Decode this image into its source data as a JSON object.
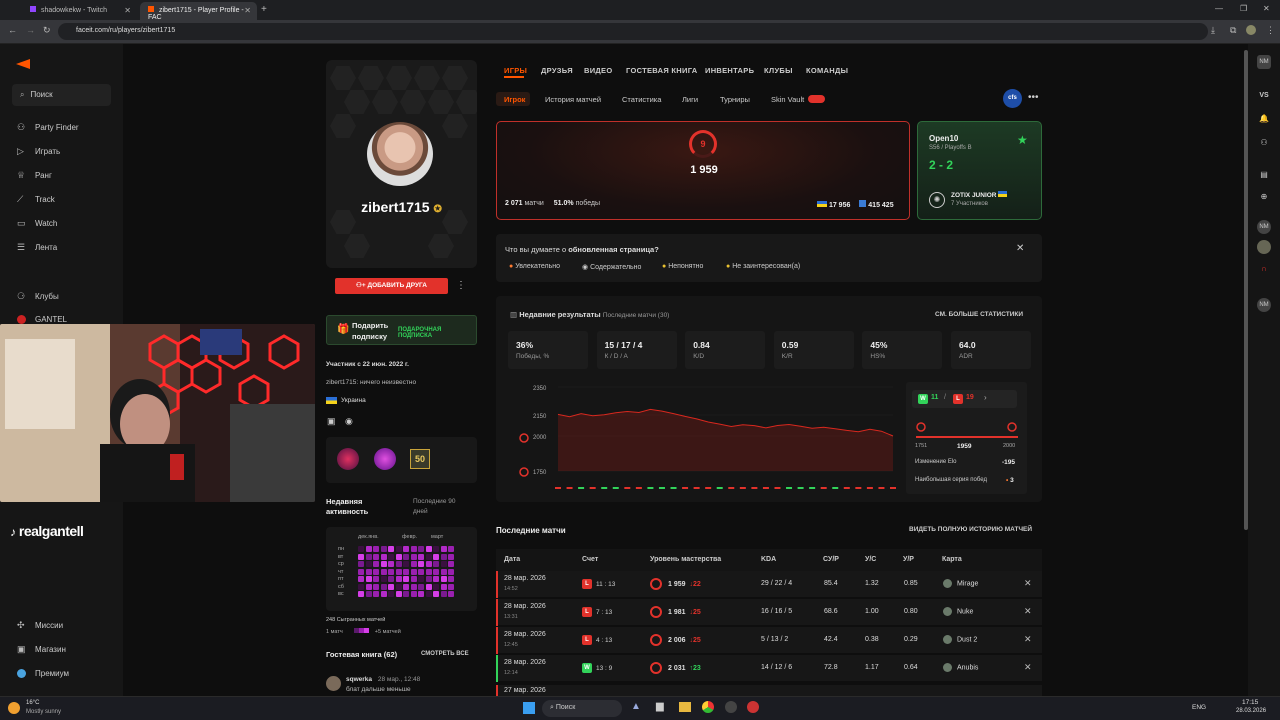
{
  "browser": {
    "tabs": [
      {
        "label": "shadowkekw - Twitch",
        "active": false
      },
      {
        "label": "zibert1715 - Player Profile - FAC",
        "active": true
      }
    ],
    "url": "faceit.com/ru/players/zibert1715"
  },
  "sidebar": {
    "search_label": "Поиск",
    "items": [
      "Party Finder",
      "Играть",
      "Ранг",
      "Track",
      "Watch",
      "Лента"
    ],
    "clubs_label": "Клубы",
    "club_name": "GANTEL",
    "bottom_items": [
      "Миссии",
      "Магазин",
      "Премиум"
    ]
  },
  "overlay": {
    "streamer": "realgantell"
  },
  "profile": {
    "nickname": "zibert1715",
    "add_friend": "ДОБАВИТЬ ДРУГА",
    "gift_line1": "Подарить",
    "gift_line2": "подписку",
    "gift_badge": "ПОДАРОЧНАЯ ПОДПИСКА",
    "member_since": "Участник с 22 июн. 2022 г.",
    "bio": "zibert1715: ничего неизвестно",
    "country": "Украина",
    "badge_50": "50",
    "activity_title_1": "Недавняя",
    "activity_title_2": "активность",
    "activity_range_1": "Последние 90",
    "activity_range_2": "дней",
    "months": [
      "дек.янв.",
      "февр.",
      "март"
    ],
    "days": [
      "пн",
      "вт",
      "ср",
      "чт",
      "пт",
      "сб",
      "вс"
    ],
    "matches_played": "248 Сыгранных матчей",
    "legend_min": "1 матч",
    "legend_max": "+5 матчей",
    "guestbook_title": "Гостевая книга (62)",
    "guestbook_all": "СМОТРЕТЬ ВСЕ",
    "guest_name": "sqwerka",
    "guest_date": "28 мар., 12:48",
    "guest_text": "блат дальше меньше"
  },
  "topnav": [
    "ИГРЫ",
    "ДРУЗЬЯ",
    "ВИДЕО",
    "ГОСТЕВАЯ КНИГА",
    "ИНВЕНТАРЬ",
    "КЛУБЫ",
    "КОМАНДЫ"
  ],
  "subnav": [
    "Игрок",
    "История матчей",
    "Статистика",
    "Лиги",
    "Турниры",
    "Skin Vault"
  ],
  "rank": {
    "level": "9",
    "elo": "1 959",
    "matches": "2 071",
    "matches_label": "матчи",
    "winrate": "51.0%",
    "winrate_label": "победы",
    "country_rank": "17 956",
    "global_rank": "415 425"
  },
  "tournament": {
    "name": "Open10",
    "stage": "S56 / Playoffs B",
    "score": "2 - 2",
    "team": "ZOTIX JUNIOR",
    "members": "7 Участников"
  },
  "feedback": {
    "question_a": "Что вы думаете о ",
    "question_b": "обновленная страница?",
    "options": [
      "Увлекательно",
      "Содержательно",
      "Непонятно",
      "Не заинтересован(а)"
    ]
  },
  "recent": {
    "title": "Недавние результаты",
    "subtitle": "Последние матчи (30)",
    "more": "СМ. БОЛЬШЕ СТАТИСТИКИ",
    "stats": [
      {
        "value": "36%",
        "label": "Победы, %"
      },
      {
        "value": "15 / 17 / 4",
        "label": "К / D / A"
      },
      {
        "value": "0.84",
        "label": "K/D"
      },
      {
        "value": "0.59",
        "label": "K/R"
      },
      {
        "value": "45%",
        "label": "HS%"
      },
      {
        "value": "64.0",
        "label": "ADR"
      }
    ],
    "wins": "11",
    "losses": "19",
    "elo_min": "1751",
    "elo_cur": "1959",
    "elo_max": "2000",
    "elo_change_label": "Изменение Elo",
    "elo_change": "-195",
    "streak_label": "Наибольшая серия побед",
    "streak": "3"
  },
  "chart_data": {
    "type": "line",
    "yticks": [
      "2350",
      "2150",
      "2000",
      "1750"
    ],
    "ylim": [
      1750,
      2350
    ],
    "values": [
      2154,
      2138,
      2160,
      2145,
      2152,
      2166,
      2175,
      2168,
      2190,
      2178,
      2160,
      2140,
      2122,
      2100,
      2085,
      2068,
      2080,
      2074,
      2058,
      2075,
      2082,
      2070,
      2055,
      2063,
      2052,
      2040,
      2030,
      2048,
      2034,
      2000
    ],
    "results": [
      "L",
      "L",
      "W",
      "L",
      "W",
      "W",
      "L",
      "L",
      "W",
      "W",
      "W",
      "L",
      "L",
      "L",
      "W",
      "L",
      "L",
      "L",
      "L",
      "L",
      "W",
      "W",
      "W",
      "L",
      "W",
      "L",
      "L",
      "L",
      "L",
      "L"
    ]
  },
  "matches": {
    "title": "Последние матчи",
    "full_history": "ВИДЕТЬ ПОЛНУЮ ИСТОРИЮ МАТЧЕЙ",
    "headers": [
      "Дата",
      "Счет",
      "Уровень мастерства",
      "KDA",
      "СУ/Р",
      "У/С",
      "У/Р",
      "Карта"
    ],
    "rows": [
      {
        "date": "28 мар. 2026",
        "time": "14:52",
        "result": "L",
        "score": "11 : 13",
        "elo": "1 959",
        "delta": "22",
        "kda": "29 / 22 / 4",
        "adr": "85.4",
        "kd": "1.32",
        "kr": "0.85",
        "map": "Mirage"
      },
      {
        "date": "28 мар. 2026",
        "time": "13:31",
        "result": "L",
        "score": "7 : 13",
        "elo": "1 981",
        "delta": "25",
        "kda": "16 / 16 / 5",
        "adr": "68.6",
        "kd": "1.00",
        "kr": "0.80",
        "map": "Nuke"
      },
      {
        "date": "28 мар. 2026",
        "time": "12:45",
        "result": "L",
        "score": "4 : 13",
        "elo": "2 006",
        "delta": "25",
        "kda": "5 / 13 / 2",
        "adr": "42.4",
        "kd": "0.38",
        "kr": "0.29",
        "map": "Dust 2"
      },
      {
        "date": "28 мар. 2026",
        "time": "12:14",
        "result": "W",
        "score": "13 : 9",
        "elo": "2 031",
        "delta": "23",
        "kda": "14 / 12 / 6",
        "adr": "72.8",
        "kd": "1.17",
        "kr": "0.64",
        "map": "Anubis"
      }
    ],
    "partial_row_date": "27 мар. 2026"
  },
  "taskbar": {
    "temp": "16°C",
    "weather": "Mostly sunny",
    "search": "Поиск",
    "lang": "ENG",
    "time": "17:15",
    "date": "28.03.2026"
  },
  "colors": {
    "accent": "#ff5500",
    "red": "#e2322b",
    "green": "#32d35a",
    "bg": "#0e0e0e"
  }
}
